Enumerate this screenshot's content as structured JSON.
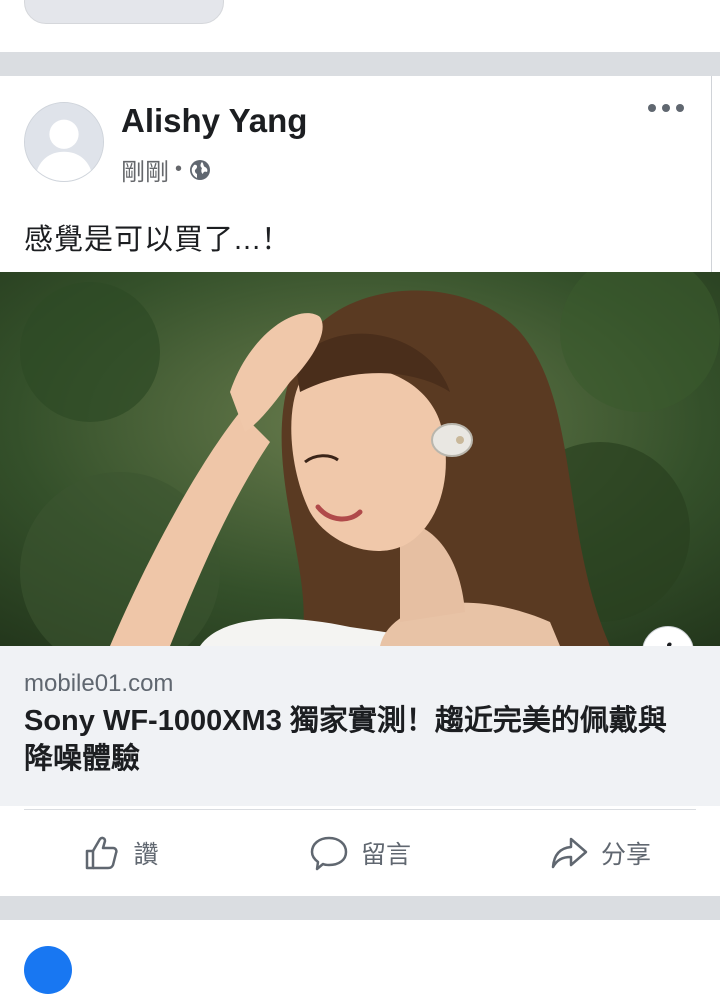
{
  "post": {
    "author": "Alishy Yang",
    "time": "剛剛",
    "separator": "•",
    "text": "感覺是可以買了...！",
    "link": {
      "domain": "mobile01.com",
      "title": "Sony WF-1000XM3 獨家實測！趨近完美的佩戴與降噪體驗"
    },
    "actions": {
      "like": "讚",
      "comment": "留言",
      "share": "分享"
    }
  },
  "icons": {
    "avatar": "person-silhouette",
    "privacy": "globe-icon",
    "more": "more-options-icon",
    "info": "info-icon",
    "like": "thumbs-up-icon",
    "comment": "comment-bubble-icon",
    "share": "share-arrow-icon"
  },
  "colors": {
    "link_box_bg": "#f0f2f5",
    "separator": "#dadde1",
    "secondary_text": "#606770",
    "brand_blue": "#1877f2"
  }
}
